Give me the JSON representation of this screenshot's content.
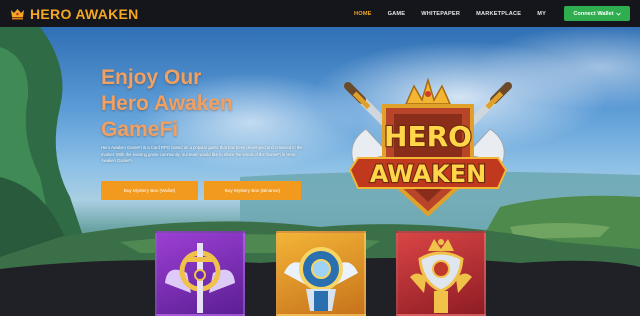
{
  "brand": {
    "name": "HERO AWAKEN",
    "icon": "hero-awaken-crest-icon"
  },
  "nav": {
    "items": [
      {
        "label": "HOME",
        "active": true
      },
      {
        "label": "GAME",
        "active": false
      },
      {
        "label": "WHITEPAPER",
        "active": false
      },
      {
        "label": "MARKETPLACE",
        "active": false
      },
      {
        "label": "MY",
        "active": false
      }
    ],
    "connect_button": "Connect Wallet",
    "connect_icon": "chevron-down-icon"
  },
  "hero": {
    "headline": [
      "Enjoy Our",
      "Hero Awaken",
      "GameFi"
    ],
    "description": "Hero Awaken GameFi is a Card RPG based on a popular game that has been developed and released in the market. With the existing game community, our team would like to share the vision of the GameFi in Hero Awaken GameFi.",
    "buttons": [
      "Buy Mystery Box (Wallet)",
      "Buy Mystery Box (Binance)"
    ],
    "logo": {
      "line1": "HERO",
      "line2": "AWAKEN"
    }
  },
  "cards": [
    {
      "icon": "winged-sword-emblem-icon",
      "rarity_color": "#9b3fd4"
    },
    {
      "icon": "winged-shield-emblem-icon",
      "rarity_color": "#f3b437"
    },
    {
      "icon": "crown-chalice-emblem-icon",
      "rarity_color": "#d94545"
    }
  ],
  "colors": {
    "accent_orange": "#f5a623",
    "connect_green": "#2eae4f",
    "cta_orange": "#f29a1e",
    "nav_bg": "#14161b",
    "headline": "#f2a061"
  }
}
